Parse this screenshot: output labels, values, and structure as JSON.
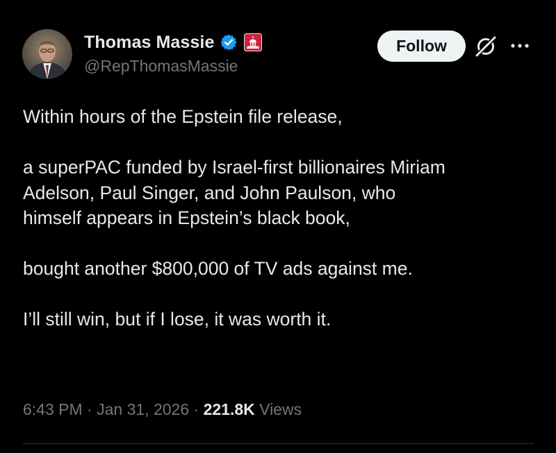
{
  "author": {
    "display_name": "Thomas Massie",
    "handle": "@RepThomasMassie",
    "verified_icon": "verified-badge-icon",
    "affiliation_icon": "us-capitol-icon"
  },
  "actions": {
    "follow_label": "Follow",
    "grok_icon": "grok-icon",
    "more_icon": "more-options-icon"
  },
  "tweet": {
    "paragraphs": [
      "Within hours of the Epstein file release,",
      "a superPAC funded by Israel-first billionaires Miriam\nAdelson, Paul Singer, and John Paulson, who\nhimself appears in Epstein’s black book,",
      "bought another $800,000 of TV ads against me.",
      "I’ll still win, but if I lose, it was worth it."
    ]
  },
  "meta": {
    "time": "6:43 PM",
    "separator": " · ",
    "date": "Jan 31, 2026",
    "views_count": "221.8K",
    "views_label": "Views"
  },
  "colors": {
    "background": "#000000",
    "text_primary": "#e7e9ea",
    "text_secondary": "#71767b",
    "verified_blue": "#1d9bf0",
    "affiliation_red": "#c9243f",
    "follow_bg": "#eff3f4",
    "divider": "#2f3336"
  }
}
